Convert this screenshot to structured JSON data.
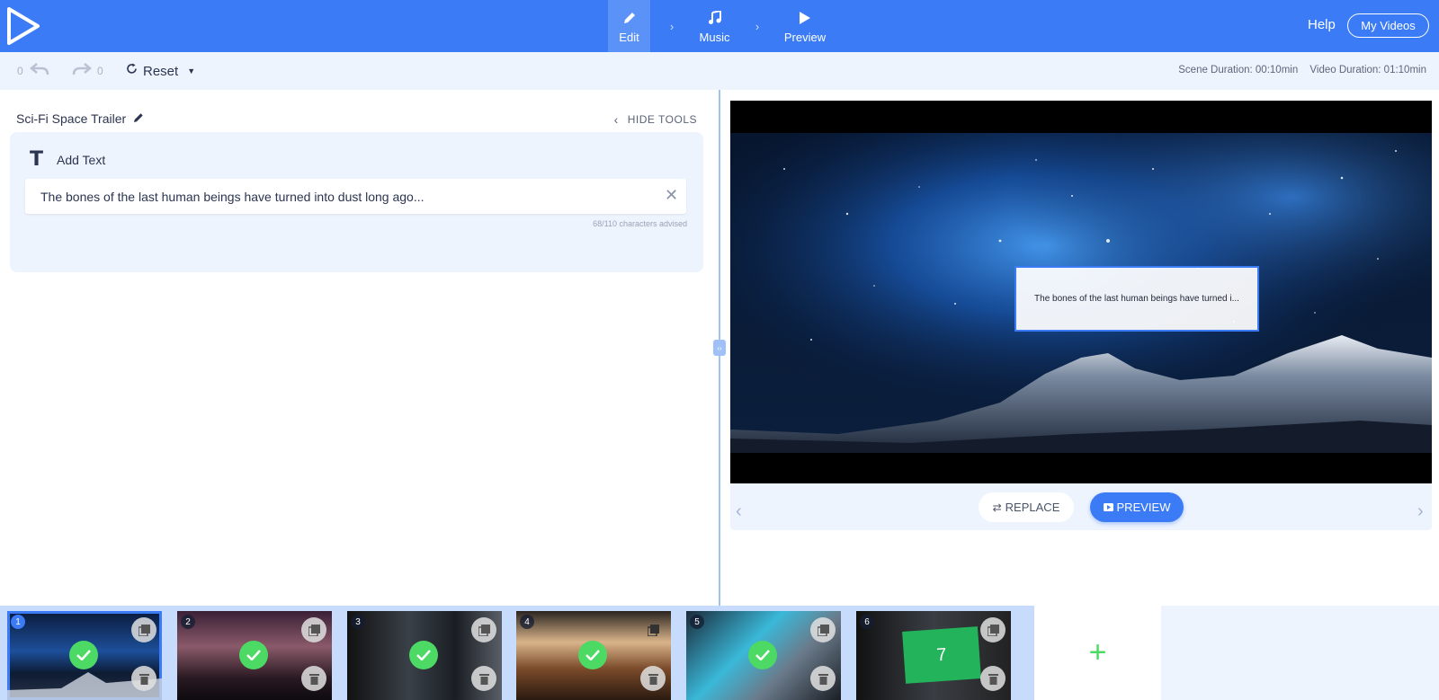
{
  "header": {
    "steps": [
      {
        "label": "Edit",
        "icon": "pencil-icon",
        "active": true
      },
      {
        "label": "Music",
        "icon": "music-note-icon",
        "active": false
      },
      {
        "label": "Preview",
        "icon": "play-icon",
        "active": false
      }
    ],
    "help_label": "Help",
    "my_videos_label": "My Videos"
  },
  "toolbar": {
    "undo_count": "0",
    "redo_count": "0",
    "reset_label": "Reset",
    "scene_duration": "Scene Duration: 00:10min",
    "video_duration": "Video Duration: 01:10min"
  },
  "editor": {
    "project_title": "Sci-Fi Space Trailer",
    "hide_tools_label": "HIDE TOOLS",
    "add_text_label": "Add Text",
    "text_value": "The bones of the last human beings have turned into dust long ago...",
    "char_hint": "68/110 characters advised"
  },
  "preview": {
    "overlay_text": "The bones of the last human beings have turned i...",
    "replace_label": "REPLACE",
    "preview_label": "PREVIEW"
  },
  "scenes": [
    {
      "number": "1",
      "completed": true,
      "selected": true
    },
    {
      "number": "2",
      "completed": true,
      "selected": false
    },
    {
      "number": "3",
      "completed": true,
      "selected": false
    },
    {
      "number": "4",
      "completed": true,
      "selected": false
    },
    {
      "number": "5",
      "completed": true,
      "selected": false
    },
    {
      "number": "6",
      "completed": false,
      "selected": false,
      "label": "7"
    }
  ],
  "colors": {
    "brand_blue": "#3b7cf6",
    "panel_bg": "#eef4fe",
    "success_green": "#4cd964"
  }
}
